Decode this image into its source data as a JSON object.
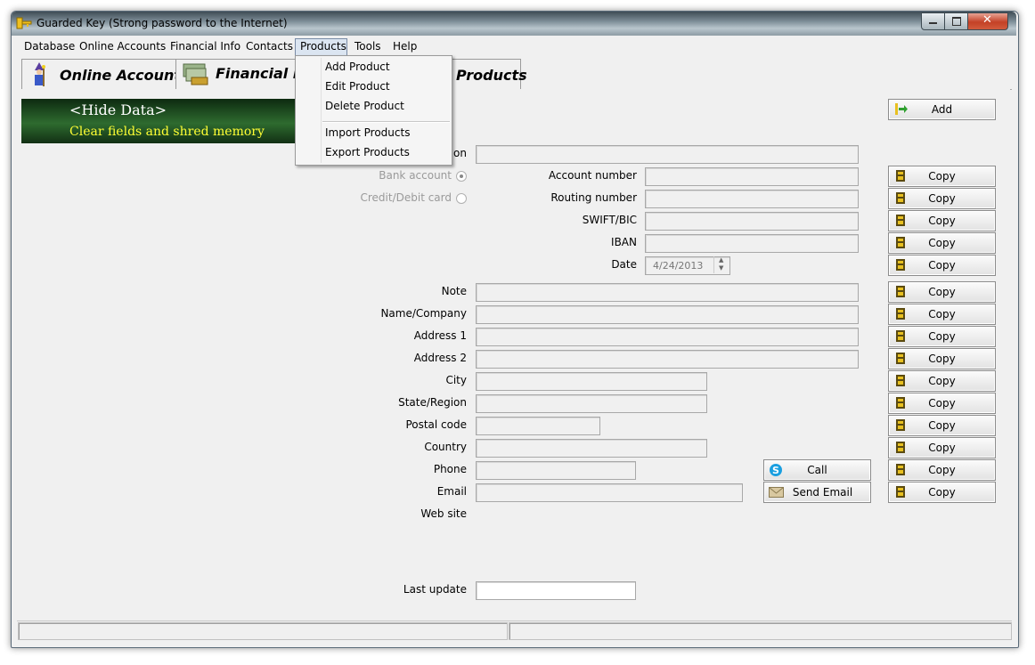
{
  "window": {
    "title": "Guarded Key (Strong password to the Internet)"
  },
  "menu": [
    "Database",
    "Online Accounts",
    "Financial Info",
    "Contacts",
    "Products",
    "Tools",
    "Help"
  ],
  "tabs": {
    "online_accounts": "Online Accounts",
    "financial_info": "Financial In",
    "products": "Products"
  },
  "dropdown": {
    "add": "Add Product",
    "edit": "Edit Product",
    "delete": "Delete Product",
    "import": "Import Products",
    "export": "Export Products"
  },
  "panel": {
    "hide_data": "<Hide Data>",
    "clear": "Clear fields and shred memory"
  },
  "buttons": {
    "add": "Add",
    "copy": "Copy",
    "call": "Call",
    "send_email": "Send Email"
  },
  "form": {
    "description_label": "ion",
    "bank_account": "Bank account",
    "credit_debit": "Credit/Debit card",
    "account_number": "Account number",
    "routing_number": "Routing number",
    "swift_bic": "SWIFT/BIC",
    "iban": "IBAN",
    "date_label": "Date",
    "date_value": "4/24/2013",
    "note": "Note",
    "name_company": "Name/Company",
    "address1": "Address 1",
    "address2": "Address 2",
    "city": "City",
    "state_region": "State/Region",
    "postal_code": "Postal code",
    "country": "Country",
    "phone": "Phone",
    "email": "Email",
    "web_site": "Web site",
    "last_update": "Last update"
  },
  "colors": {
    "panel_bg": "#1e4a20",
    "panel_subtext": "#ffff33",
    "titlebar": "#7c8c96"
  }
}
